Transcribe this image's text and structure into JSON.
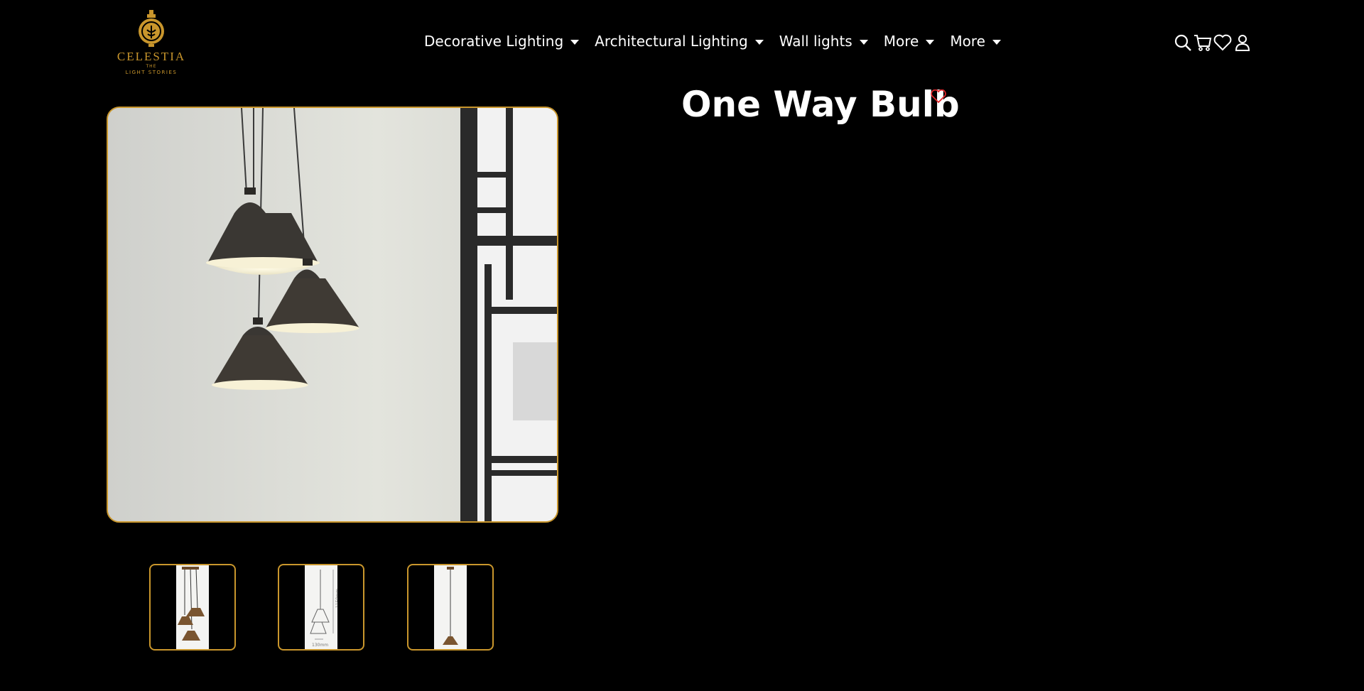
{
  "logo": {
    "brand": "CELESTIA",
    "tag_top": "THE",
    "tag_bottom": "LIGHT STORIES"
  },
  "nav": {
    "items": [
      {
        "label": "Decorative Lighting"
      },
      {
        "label": "Architectural Lighting"
      },
      {
        "label": "Wall lights"
      },
      {
        "label": "More"
      },
      {
        "label": "More"
      }
    ]
  },
  "header_icons": [
    "search-icon",
    "cart-icon",
    "heart-icon",
    "user-icon"
  ],
  "product": {
    "title": "One Way Bulb",
    "thumbnails": [
      {
        "alt": "pendant-cluster-photo"
      },
      {
        "alt": "pendant-dimension-drawing",
        "dim_height": "1150mm",
        "dim_width": "130mm"
      },
      {
        "alt": "single-pendant-photo"
      }
    ]
  },
  "colors": {
    "accent": "#c9962c",
    "wish": "#e0262a",
    "background": "#000000"
  }
}
